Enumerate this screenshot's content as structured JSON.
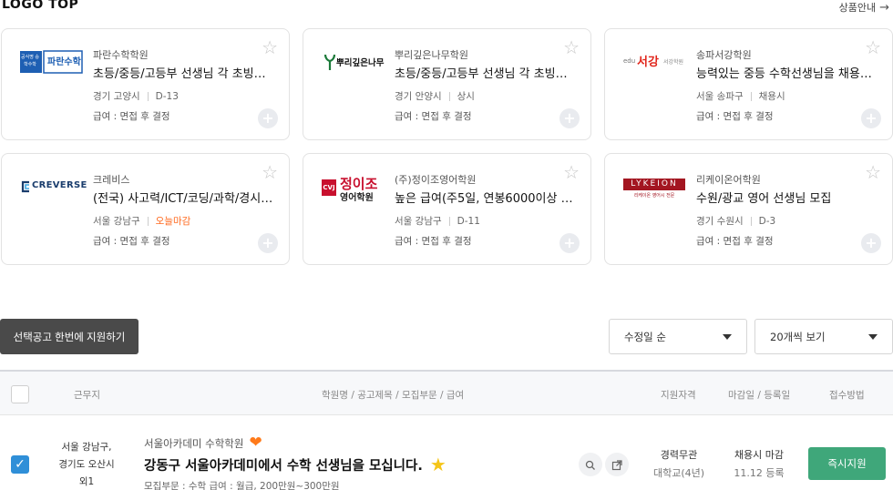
{
  "header": {
    "section_title": "LOGO TOP",
    "more_link": "상품안내"
  },
  "cards": [
    {
      "academy": "파란수학학원",
      "title": "초등/중등/고등부 선생님 각 초빙합니..",
      "location": "경기 고양시",
      "deadline": "D-13",
      "salary": "급여 : 면접 후 결정",
      "logo_text": "파란수학",
      "logo_sub": "공식명 승학수학"
    },
    {
      "academy": "뿌리깊은나무학원",
      "title": "초등/중등/고등부 선생님 각 초빙합니..",
      "location": "경기 안양시",
      "deadline": "상시",
      "salary": "급여 : 면접 후 결정",
      "logo_text": "뿌리깊은나무"
    },
    {
      "academy": "송파서강학원",
      "title": "능력있는 중등 수학선생님을 채용합니..",
      "location": "서울 송파구",
      "deadline": "채용시",
      "salary": "급여 : 면접 후 결정",
      "logo_pre": "edu",
      "logo_text": "서강",
      "logo_sub": "서강학원"
    },
    {
      "academy": "크레비스",
      "title": "(전국) 사고력/ICT/코딩/과학/경시/특..",
      "location": "서울 강남구",
      "deadline": "오늘마감",
      "salary": "급여 : 면접 후 결정",
      "logo_text": "CREVERSE"
    },
    {
      "academy": "(주)정이조영어학원",
      "title": "높은 급여(주5일, 연봉6000이상 도전..",
      "location": "서울 강남구",
      "deadline": "D-11",
      "salary": "급여 : 면접 후 결정",
      "logo_text": "정이조",
      "logo_sub": "영어학원",
      "logo_badge": "CVJ"
    },
    {
      "academy": "리케이온어학원",
      "title": "수원/광교 영어 선생님 모집",
      "location": "경기 수원시",
      "deadline": "D-3",
      "salary": "급여 : 면접 후 결정",
      "logo_text": "LYKEION",
      "logo_sub": "리케이온 영어시 전문"
    }
  ],
  "toolbar": {
    "apply_selected": "선택공고 한번에 지원하기",
    "sort_value": "수정일 순",
    "page_size_value": "20개씩 보기"
  },
  "table": {
    "headers": {
      "location": "근무지",
      "info": "학원명 / 공고제목 / 모집부문 / 급여",
      "qualification": "지원자격",
      "deadline": "마감일 / 등록일",
      "method": "접수방법"
    },
    "rows": [
      {
        "location_line1": "서울 강남구,",
        "location_line2": "경기도 오산시",
        "location_line3": "외1",
        "academy": "서울아카데미 수학학원",
        "title": "강동구 서울아카데미에서 수학 선생님을 모십니다.",
        "subinfo": "모집부문 : 수학    급여 : 월급, 200만원~300만원",
        "qual_line1": "경력무관",
        "qual_line2": "대학교(4년)",
        "deadline_line1": "채용시 마감",
        "deadline_line2": "11.12 등록",
        "apply_label": "즉시지원"
      }
    ]
  },
  "colors": {
    "urgent": "#ff6a1f",
    "apply_green": "#3fa77a",
    "check_blue": "#2f8fd8",
    "heart": "#ff7a1a",
    "star_yellow": "#f5c518"
  },
  "icons": {
    "more_arrow": "arrow-right-icon",
    "favorite": "star-outline-icon",
    "add": "plus-icon",
    "search": "search-icon",
    "external": "external-link-icon",
    "heart": "heart-icon",
    "highlight": "star-filled-icon",
    "dropdown": "caret-down-icon"
  }
}
